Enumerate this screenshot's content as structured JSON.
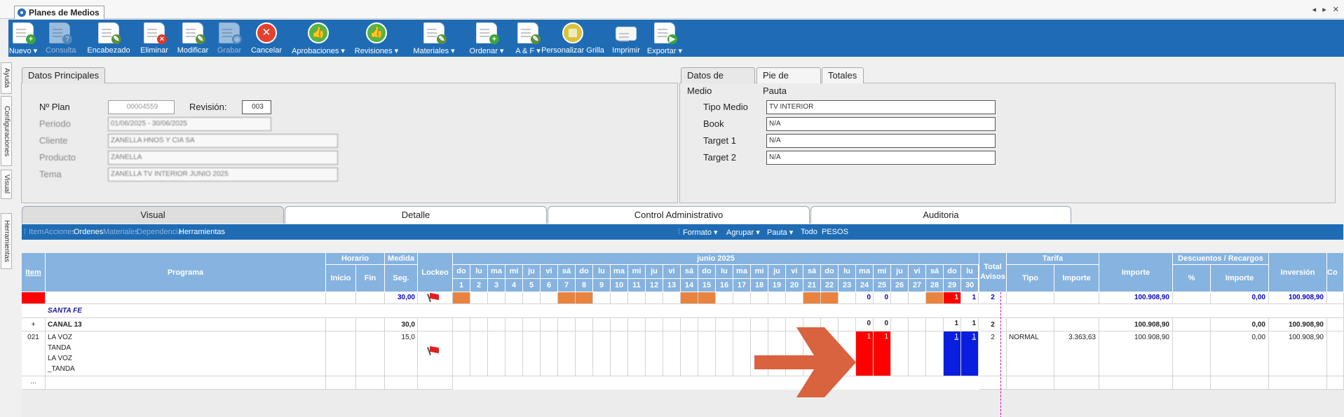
{
  "window": {
    "title": "Planes de Medios",
    "controls": "◂ ▸ ✕"
  },
  "toolbar": [
    {
      "id": "nuevo",
      "label": "Nuevo ▾",
      "icon": "new-doc-icon",
      "disabled": false
    },
    {
      "id": "consulta",
      "label": "Consulta",
      "icon": "query-doc-icon",
      "disabled": true
    },
    {
      "id": "encabezado",
      "label": "Encabezado",
      "icon": "edit-doc-icon",
      "disabled": false
    },
    {
      "id": "eliminar",
      "label": "Eliminar",
      "icon": "delete-doc-icon",
      "disabled": false
    },
    {
      "id": "modificar",
      "label": "Modificar",
      "icon": "modify-doc-icon",
      "disabled": false
    },
    {
      "id": "grabar",
      "label": "Grabar",
      "icon": "save-icon",
      "disabled": true
    },
    {
      "id": "cancelar",
      "label": "Cancelar",
      "icon": "cancel-icon",
      "disabled": false
    },
    {
      "id": "aprobaciones",
      "label": "Aprobaciones ▾",
      "icon": "thumbs-up-icon",
      "disabled": false
    },
    {
      "id": "revisiones",
      "label": "Revisiones ▾",
      "icon": "review-icon",
      "disabled": false
    },
    {
      "id": "materiales",
      "label": "Materiales ▾",
      "icon": "materials-icon",
      "disabled": false
    },
    {
      "id": "ordenar",
      "label": "Ordenar ▾",
      "icon": "order-doc-icon",
      "disabled": false
    },
    {
      "id": "af",
      "label": "A & F ▾",
      "icon": "af-doc-icon",
      "disabled": false
    },
    {
      "id": "personalizar",
      "label": "Personalizar Grilla",
      "icon": "grid-icon",
      "disabled": false
    },
    {
      "id": "imprimir",
      "label": "Imprimir",
      "icon": "printer-icon",
      "disabled": false
    },
    {
      "id": "exportar",
      "label": "Exportar ▾",
      "icon": "export-icon",
      "disabled": false
    }
  ],
  "left_tabs": [
    "Ayuda",
    "Configuraciones",
    "Visual",
    "Herramientas"
  ],
  "datos_principales": {
    "tab": "Datos Principales",
    "nplan_label": "Nº Plan",
    "nplan_value": "00004559",
    "revision_label": "Revisión:",
    "revision_value": "003",
    "periodo_label": "Periodo",
    "periodo_value": "01/06/2025 - 30/06/2025",
    "cliente_label": "Cliente",
    "cliente_value": "ZANELLA HNOS Y CIA SA",
    "producto_label": "Producto",
    "producto_value": "ZANELLA",
    "tema_label": "Tema",
    "tema_value": "ZANELLA TV INTERIOR JUNIO 2025"
  },
  "datos_medio": {
    "tabs": [
      "Datos de Medio",
      "Pie de Pauta",
      "Totales"
    ],
    "fields": [
      {
        "label": "Tipo Medio",
        "value": "TV INTERIOR"
      },
      {
        "label": "Book",
        "value": "N/A"
      },
      {
        "label": "Target 1",
        "value": "N/A"
      },
      {
        "label": "Target 2",
        "value": "N/A"
      }
    ]
  },
  "section_tabs": [
    "Visual",
    "Detalle",
    "Control Administrativo",
    "Auditoria"
  ],
  "subbar": {
    "left": [
      {
        "label": "Item",
        "disabled": true
      },
      {
        "label": "Acciones",
        "disabled": true
      },
      {
        "label": "Ordenes",
        "disabled": false
      },
      {
        "label": "Materiales",
        "disabled": true
      },
      {
        "label": "Dependencia",
        "disabled": true
      },
      {
        "label": "Herramientas",
        "disabled": false
      }
    ],
    "right": [
      "Formato ▾",
      "Agrupar ▾",
      "Pauta ▾",
      "Todo",
      "PESOS"
    ]
  },
  "grid": {
    "headers": {
      "item": "Item",
      "programa": "Programa",
      "horario": "Horario",
      "inicio": "Inicio",
      "fin": "Fin",
      "medida": "Medida",
      "seg": "Seg.",
      "lockeo": "Lockeo",
      "month": "junio 2025",
      "total_avisos": "Total Avisos",
      "tarifa": "Tarifa",
      "tipo": "Tipo",
      "importe": "Importe",
      "importe2": "Importe",
      "descuentos": "Descuentos / Recargos",
      "pct": "%",
      "importe3": "Importe",
      "inversion": "Inversión",
      "extra": "Co"
    },
    "days": [
      {
        "d": "do",
        "n": "1"
      },
      {
        "d": "lu",
        "n": "2"
      },
      {
        "d": "ma",
        "n": "3"
      },
      {
        "d": "mi",
        "n": "4"
      },
      {
        "d": "ju",
        "n": "5"
      },
      {
        "d": "vi",
        "n": "6"
      },
      {
        "d": "sá",
        "n": "7"
      },
      {
        "d": "do",
        "n": "8"
      },
      {
        "d": "lu",
        "n": "9"
      },
      {
        "d": "ma",
        "n": "10"
      },
      {
        "d": "mi",
        "n": "11"
      },
      {
        "d": "ju",
        "n": "12"
      },
      {
        "d": "vi",
        "n": "13"
      },
      {
        "d": "sá",
        "n": "14"
      },
      {
        "d": "do",
        "n": "15"
      },
      {
        "d": "lu",
        "n": "16"
      },
      {
        "d": "ma",
        "n": "17"
      },
      {
        "d": "mi",
        "n": "18"
      },
      {
        "d": "ju",
        "n": "19"
      },
      {
        "d": "vi",
        "n": "20"
      },
      {
        "d": "sá",
        "n": "21"
      },
      {
        "d": "do",
        "n": "22"
      },
      {
        "d": "lu",
        "n": "23"
      },
      {
        "d": "ma",
        "n": "24"
      },
      {
        "d": "mi",
        "n": "25"
      },
      {
        "d": "ju",
        "n": "26"
      },
      {
        "d": "vi",
        "n": "27"
      },
      {
        "d": "sá",
        "n": "28"
      },
      {
        "d": "do",
        "n": "29"
      },
      {
        "d": "lu",
        "n": "30"
      }
    ],
    "weekend_days": [
      1,
      7,
      8,
      14,
      15,
      21,
      22,
      28,
      29
    ],
    "total_row": {
      "seg": "30,00",
      "days": {
        "24": "0",
        "25": "0",
        "29": "1",
        "30": "1"
      },
      "red_day": "29",
      "total": "2",
      "importe": "100.908,90",
      "desc_importe": "0,00",
      "inversion": "100.908,90"
    },
    "group_label": "SANTA FE",
    "canal_row": {
      "item": "+",
      "programa": "CANAL 13",
      "seg": "30,0",
      "days": {
        "24": "0",
        "25": "0",
        "29": "1",
        "30": "1"
      },
      "total": "2",
      "importe": "100.908,90",
      "desc_importe": "0,00",
      "inversion": "100.908,90"
    },
    "detail_row": {
      "item": "021",
      "programa": [
        "LA VOZ",
        "TANDA",
        "LA VOZ",
        "_TANDA"
      ],
      "seg": "15,0",
      "days": {
        "24": "1",
        "25": "1",
        "29": "1",
        "30": "1"
      },
      "red_days": [
        "24",
        "25"
      ],
      "blue_days": [
        "29",
        "30"
      ],
      "total": "2",
      "tipo": "NORMAL",
      "tarifa_importe": "3.363,63",
      "importe": "100.908,90",
      "desc_importe": "0,00",
      "inversion": "100.908,90"
    },
    "more_row": "..."
  },
  "colors": {
    "toolbar": "#1f6cb5",
    "header": "#86b3df",
    "weekend": "#e8843f",
    "arrow": "#d9623f",
    "accent_red": "#ff0000",
    "accent_blue": "#0a1ee0"
  }
}
